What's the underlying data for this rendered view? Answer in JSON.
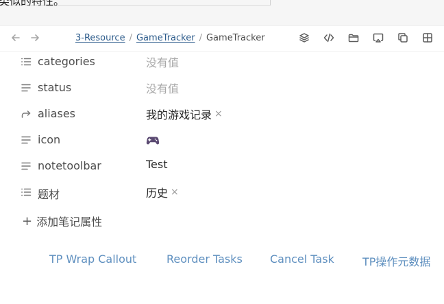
{
  "top_strip": {
    "cut_text": "类似的特性。"
  },
  "navbar": {
    "back_label": "back",
    "forward_label": "forward",
    "breadcrumb": {
      "parts": [
        "3-Resource",
        "GameTracker"
      ],
      "separator": "/",
      "current": "GameTracker"
    },
    "tools": [
      "layers-icon",
      "code-icon",
      "folder-icon",
      "cast-icon",
      "copy-icon",
      "grid-icon"
    ]
  },
  "properties": [
    {
      "key": "categories",
      "icon": "list-icon",
      "value": "没有值",
      "empty": true
    },
    {
      "key": "status",
      "icon": "text-icon",
      "value": "没有值",
      "empty": true
    },
    {
      "key": "aliases",
      "icon": "forward-arrow-icon",
      "value": "我的游戏记录",
      "removable": true
    },
    {
      "key": "icon",
      "icon": "text-icon",
      "value": "🎮"
    },
    {
      "key": "notetoolbar",
      "icon": "text-icon",
      "value": "Test"
    },
    {
      "key": "题材",
      "icon": "list-icon",
      "value": "历史",
      "removable": true
    }
  ],
  "add_property_label": "添加笔记属性",
  "remove_glyph": "×",
  "toolbar_buttons": [
    "TP Wrap Callout",
    "Reorder Tasks",
    "Cancel Task",
    "TP操作元数据"
  ],
  "colors": {
    "link": "#2b5a8a",
    "toolbar_button": "#5e8fbf",
    "muted": "#a8a8a8"
  }
}
